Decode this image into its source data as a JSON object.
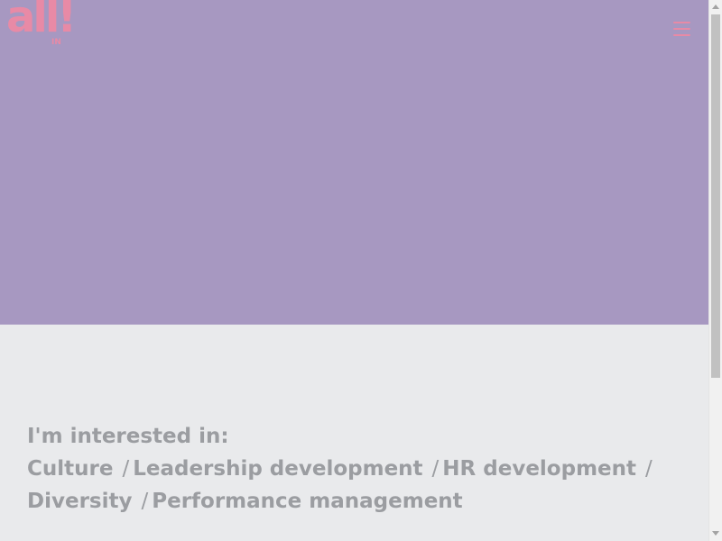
{
  "header": {
    "logo_text": "all",
    "logo_mark": "!",
    "logo_sub": "IN",
    "menu_icon": "hamburger-menu-icon"
  },
  "interests": {
    "heading": "I'm interested in:",
    "separator": "/",
    "topics": [
      "Culture",
      "Leadership development",
      "HR development",
      "Diversity",
      "Performance management"
    ]
  },
  "colors": {
    "hero_bg": "#a798c1",
    "page_bg": "#e9eaec",
    "accent_pink": "#e88aa6",
    "text_grey": "#9b9da1"
  }
}
